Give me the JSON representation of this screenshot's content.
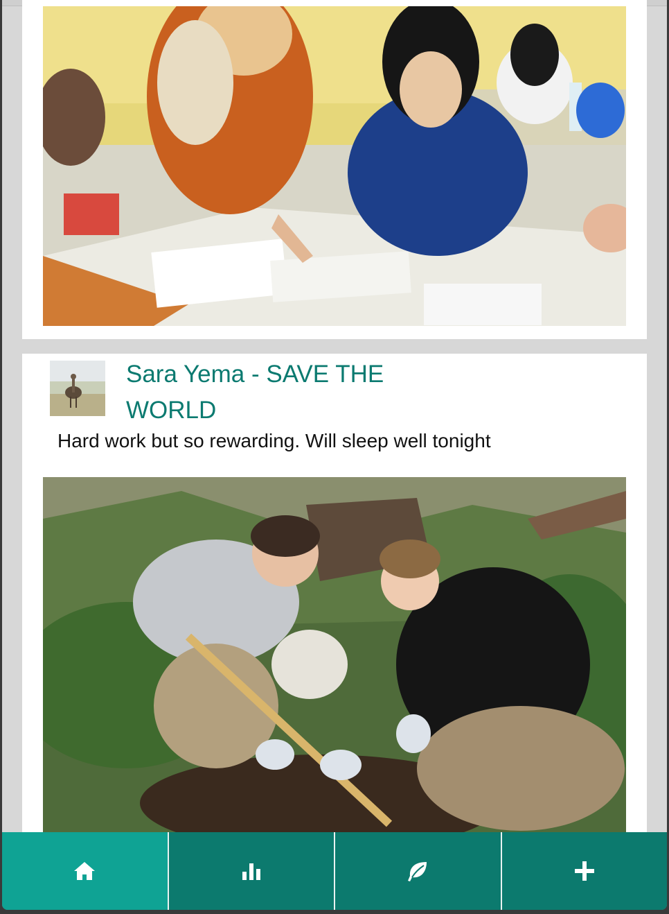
{
  "post": {
    "author_title": "Sara Yema - SAVE THE WORLD",
    "text": "Hard work but so rewarding. Will sleep well tonight"
  },
  "nav": {
    "items": [
      {
        "icon": "home-icon",
        "active": true
      },
      {
        "icon": "bar-chart-icon",
        "active": false
      },
      {
        "icon": "leaf-icon",
        "active": false
      },
      {
        "icon": "plus-icon",
        "active": false
      }
    ],
    "colors": {
      "active": "#0fa394",
      "inactive": "#0c7a6e",
      "title": "#0b7a70"
    }
  }
}
